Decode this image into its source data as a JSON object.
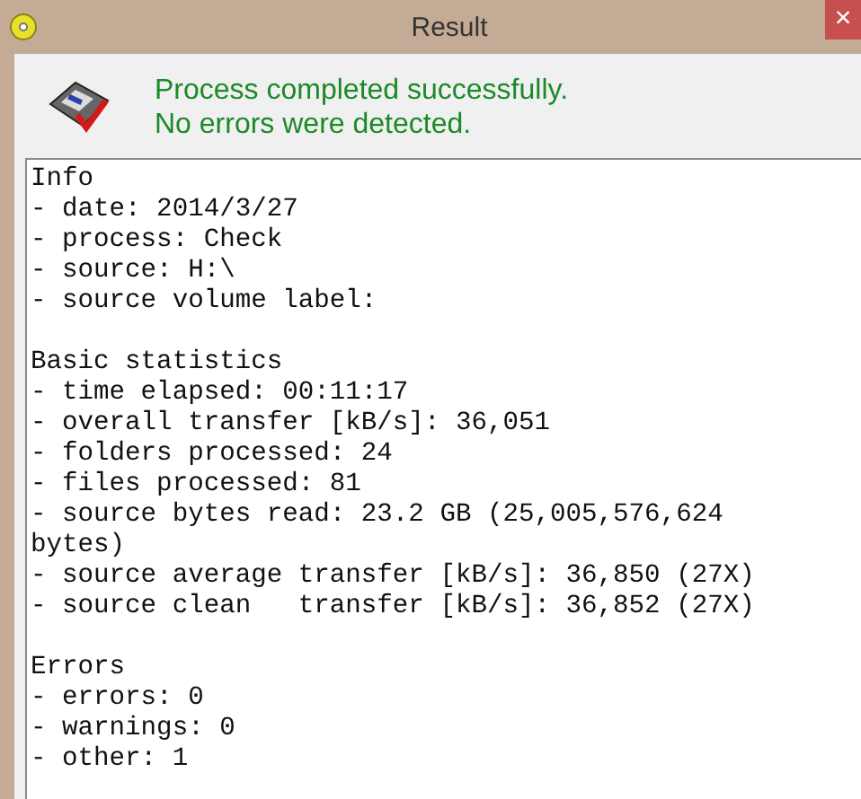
{
  "window": {
    "title": "Result",
    "close": "×"
  },
  "message": [
    "Process completed successfully.",
    "No errors were detected."
  ],
  "report": [
    {
      "heading": "Info",
      "lines": [
        "- date: 2014/3/27",
        "- process: Check",
        "- source: H:\\",
        "- source volume label:"
      ]
    },
    {
      "heading": "Basic statistics",
      "lines": [
        "- time elapsed: 00:11:17",
        "- overall transfer [kB/s]: 36,051",
        "- folders processed: 24",
        "- files processed: 81",
        "- source bytes read: 23.2 GB (25,005,576,624 bytes)",
        "- source average transfer [kB/s]: 36,850 (27X)",
        "- source clean   transfer [kB/s]: 36,852 (27X)"
      ]
    },
    {
      "heading": "Errors",
      "lines": [
        "- errors: 0",
        "- warnings: 0",
        "- other: 1"
      ]
    }
  ]
}
